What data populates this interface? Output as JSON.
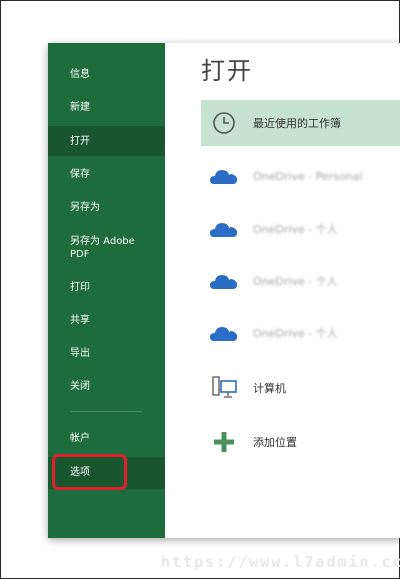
{
  "sidebar": {
    "items": [
      {
        "label": "信息"
      },
      {
        "label": "新建"
      },
      {
        "label": "打开"
      },
      {
        "label": "保存"
      },
      {
        "label": "另存为"
      },
      {
        "label": "另存为 Adobe\nPDF"
      },
      {
        "label": "打印"
      },
      {
        "label": "共享"
      },
      {
        "label": "导出"
      },
      {
        "label": "关闭"
      },
      {
        "label": "帐户"
      },
      {
        "label": "选项"
      }
    ],
    "active_item": "打开",
    "highlighted_item": "选项"
  },
  "main": {
    "title": "打开",
    "locations": [
      {
        "label": "最近使用的工作簿",
        "icon": "clock-icon",
        "selected": true
      },
      {
        "label": "OneDrive - Personal",
        "icon": "cloud-icon",
        "blurred": true
      },
      {
        "label": "OneDrive - 个人",
        "icon": "cloud-icon",
        "blurred": true
      },
      {
        "label": "OneDrive - 个人",
        "icon": "cloud-icon",
        "blurred": true
      },
      {
        "label": "OneDrive - 个人",
        "icon": "cloud-icon",
        "blurred": true
      },
      {
        "label": "计算机",
        "icon": "computer-icon"
      },
      {
        "label": "添加位置",
        "icon": "plus-icon"
      }
    ]
  },
  "watermark": "https://www.l7admin.cc",
  "colors": {
    "sidebar": "#1e6b3c",
    "sidebar_active": "#19562f",
    "selected_location": "#c7e2cf",
    "highlight_border": "#e0202a",
    "cloud": "#2b6cc4"
  }
}
